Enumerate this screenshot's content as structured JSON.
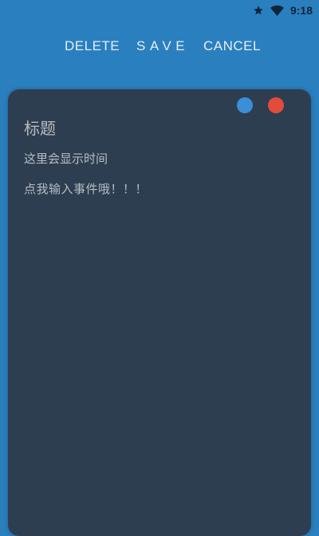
{
  "status_bar": {
    "time": "9:18",
    "icons": [
      "star-icon",
      "wifi-icon"
    ]
  },
  "toolbar": {
    "delete_label": "DELETE",
    "save_label": "SAVE",
    "cancel_label": "CANCEL"
  },
  "note": {
    "title": "标题",
    "time_text": "这里会显示时间",
    "event_placeholder": "点我输入事件哦！！！",
    "color_options": [
      {
        "name": "blue",
        "color": "#3a8fd9"
      },
      {
        "name": "red",
        "color": "#e34c3c"
      }
    ]
  },
  "colors": {
    "background": "#2a7fbf",
    "card": "#2d3e50",
    "text": "#b7bcc2"
  }
}
